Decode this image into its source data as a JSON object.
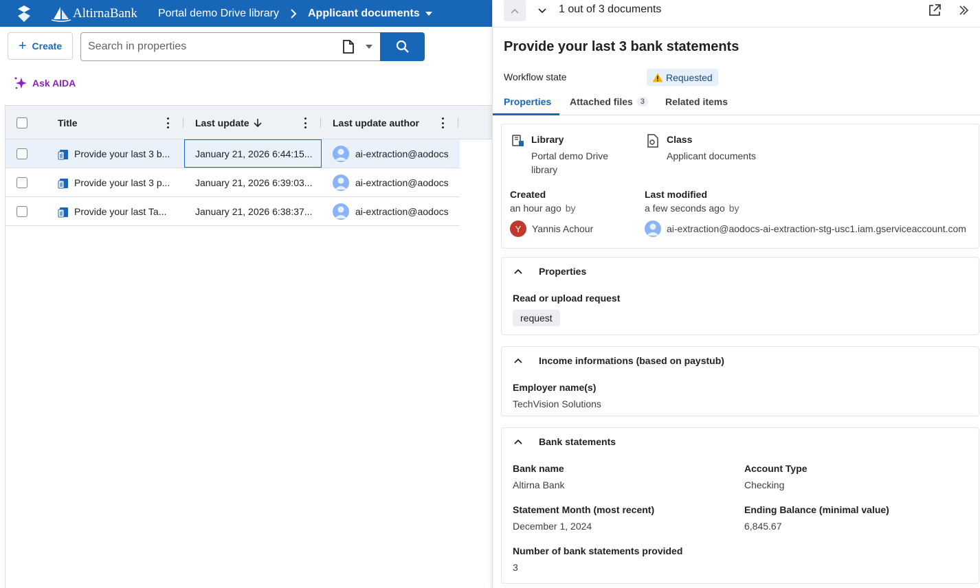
{
  "topbar": {
    "brand": "AltirnaBank",
    "breadcrumb_library": "Portal demo Drive library",
    "breadcrumb_class": "Applicant documents"
  },
  "toolbar": {
    "create_label": "Create",
    "search_placeholder": "Search in properties",
    "ask_aida_label": "Ask AIDA"
  },
  "table": {
    "headers": {
      "title": "Title",
      "last_update": "Last update",
      "last_update_author": "Last update author"
    },
    "rows": [
      {
        "title": "Provide your last 3 b...",
        "date": "January 21, 2026 6:44:15...",
        "author": "ai-extraction@aodocs"
      },
      {
        "title": "Provide your last 3 p...",
        "date": "January 21, 2026 6:39:03...",
        "author": "ai-extraction@aodocs"
      },
      {
        "title": "Provide your last Ta...",
        "date": "January 21, 2026 6:38:37...",
        "author": "ai-extraction@aodocs"
      }
    ]
  },
  "panel": {
    "counter": "1 out of 3 documents",
    "title": "Provide your last 3 bank statements",
    "workflow_label": "Workflow state",
    "workflow_state": "Requested",
    "tabs": {
      "properties": "Properties",
      "attached_files": "Attached files",
      "attached_count": "3",
      "related_items": "Related items"
    },
    "summary": {
      "library_label": "Library",
      "library_value_line1": "Portal demo Drive",
      "library_value_line2": "library",
      "class_label": "Class",
      "class_value": "Applicant documents",
      "created_label": "Created",
      "created_when": "an hour ago",
      "by": "by",
      "created_by_initial": "Y",
      "created_by": "Yannis Achour",
      "modified_label": "Last modified",
      "modified_when": "a few seconds ago",
      "modified_by": "ai-extraction@aodocs-ai-extraction-stg-usc1.iam.gserviceaccount.com"
    },
    "properties_section": {
      "title": "Properties",
      "field_label": "Read or upload request",
      "field_value": "request"
    },
    "income_section": {
      "title": "Income informations (based on paystub)",
      "employer_label": "Employer name(s)",
      "employer_value": "TechVision Solutions"
    },
    "bank_section": {
      "title": "Bank statements",
      "bank_name_label": "Bank name",
      "bank_name_value": "Altirna Bank",
      "account_type_label": "Account Type",
      "account_type_value": "Checking",
      "statement_month_label": "Statement Month (most recent)",
      "statement_month_value": "December 1, 2024",
      "ending_balance_label": "Ending Balance (minimal value)",
      "ending_balance_value": "6,845.67",
      "num_statements_label": "Number of bank statements provided",
      "num_statements_value": "3"
    }
  },
  "colors": {
    "brand_blue": "#1766b8",
    "aida_purple": "#8a24b8",
    "warning": "#f4b400"
  }
}
